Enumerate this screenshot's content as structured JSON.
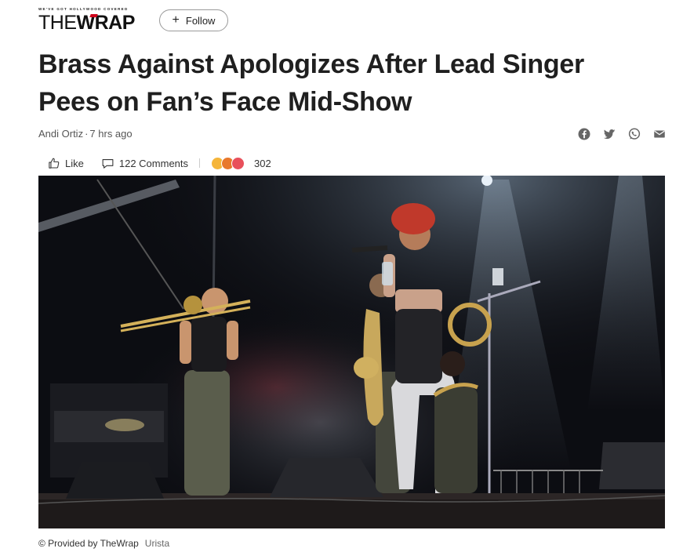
{
  "header": {
    "logo_tagline": "WE'VE GOT HOLLYWOOD COVERED",
    "logo_the": "THE",
    "logo_wrap": "WRAP",
    "follow_label": "Follow"
  },
  "article": {
    "headline": "Brass Against Apologizes After Lead Singer Pees on Fan’s Face Mid-Show",
    "author": "Andi Ortiz",
    "separator": "·",
    "time": "7 hrs ago"
  },
  "share_icons": [
    "facebook-icon",
    "twitter-icon",
    "whatsapp-icon",
    "email-icon"
  ],
  "actions": {
    "like_label": "Like",
    "comments_label": "122 Comments",
    "reaction_count": "302"
  },
  "image": {
    "credit": "© Provided by TheWrap",
    "source": "Urista"
  },
  "colors": {
    "brand_red": "#d0021b",
    "text_dark": "#1f1f1f",
    "icon_gray": "#666666"
  }
}
